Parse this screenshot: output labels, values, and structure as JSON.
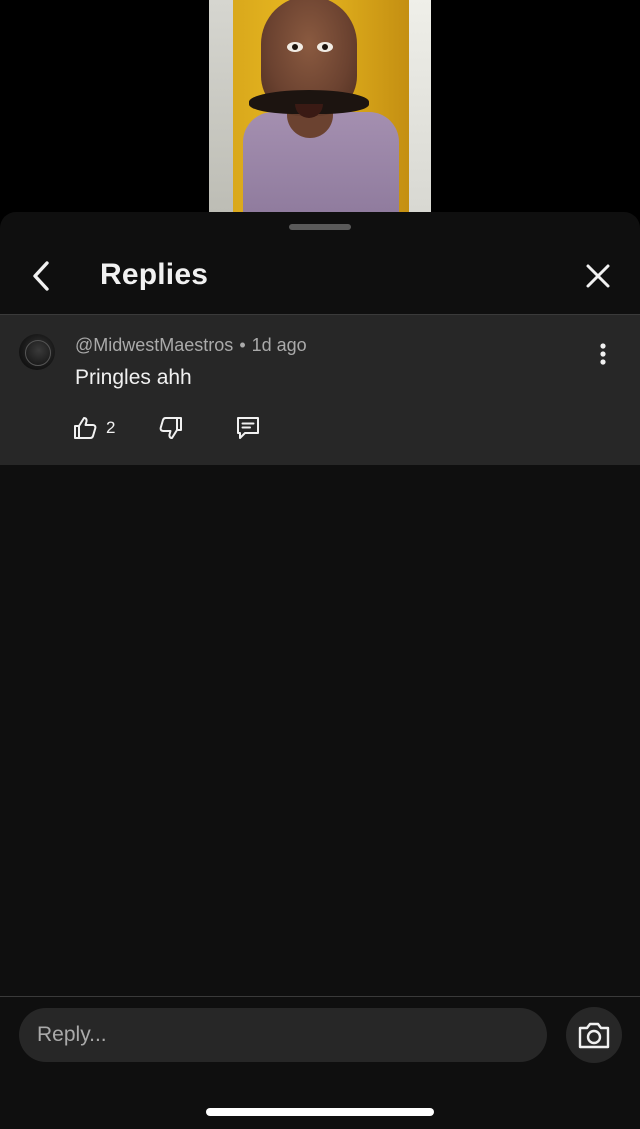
{
  "video": {
    "description_icon": "video-thumbnail"
  },
  "header": {
    "title": "Replies",
    "back_icon": "chevron-left-icon",
    "close_icon": "close-icon"
  },
  "comment": {
    "author": "@MidwestMaestros",
    "separator": "•",
    "time": "1d ago",
    "text": "Pringles ahh",
    "like_count": "2",
    "icons": {
      "like": "thumbs-up-icon",
      "dislike": "thumbs-down-icon",
      "reply": "comment-icon",
      "more": "more-vertical-icon"
    }
  },
  "composer": {
    "placeholder": "Reply...",
    "camera_icon": "camera-icon"
  },
  "colors": {
    "sheet_bg": "#0f0f0f",
    "comment_bg": "#272727",
    "text_primary": "#f1f1f1",
    "text_secondary": "#aaaaaa"
  }
}
